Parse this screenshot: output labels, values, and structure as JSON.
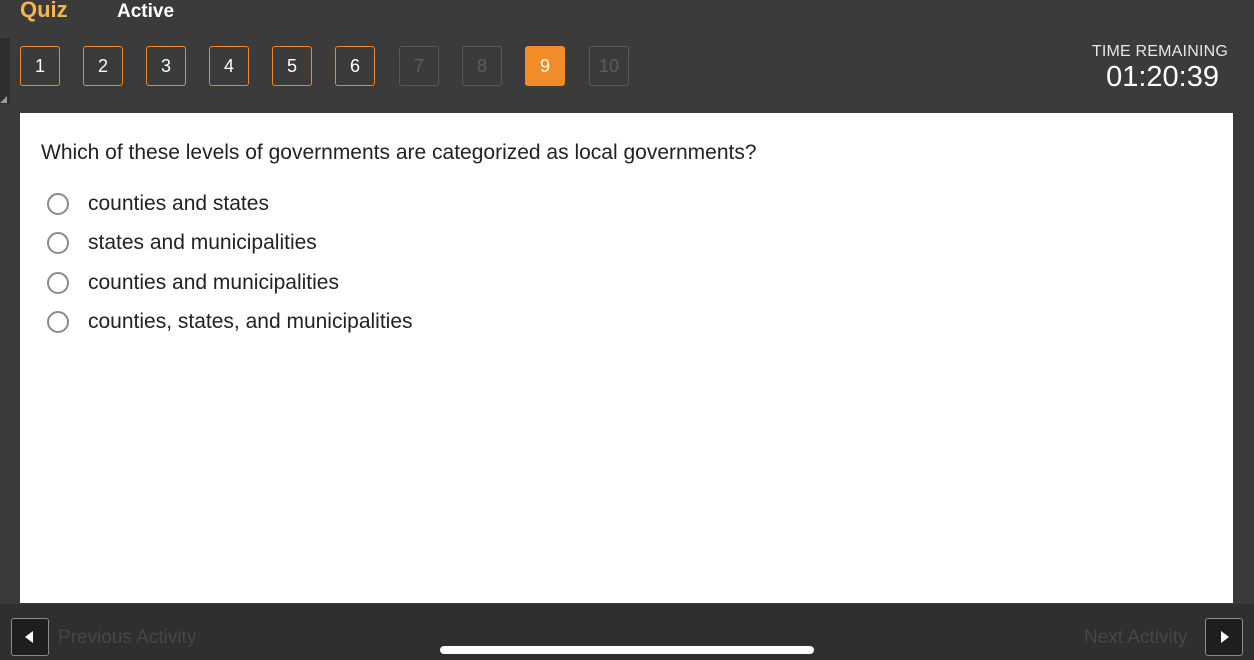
{
  "header": {
    "title": "Quiz",
    "status": "Active",
    "time_label": "TIME REMAINING",
    "time_value": "01:20:39"
  },
  "question_nav": [
    {
      "label": "1",
      "state": "answered"
    },
    {
      "label": "2",
      "state": "answered"
    },
    {
      "label": "3",
      "state": "answered"
    },
    {
      "label": "4",
      "state": "answered"
    },
    {
      "label": "5",
      "state": "answered"
    },
    {
      "label": "6",
      "state": "answered"
    },
    {
      "label": "7",
      "state": "locked"
    },
    {
      "label": "8",
      "state": "locked"
    },
    {
      "label": "9",
      "state": "current"
    },
    {
      "label": "10",
      "state": "locked"
    }
  ],
  "question": {
    "text": "Which of these levels of governments are categorized as local governments?",
    "choices": [
      "counties and states",
      "states and municipalities",
      "counties and municipalities",
      "counties, states, and municipalities"
    ]
  },
  "footer": {
    "prev_label": "Previous Activity",
    "next_label": "Next Activity"
  },
  "colors": {
    "accent": "#f28c28",
    "title": "#f4b64c",
    "background": "#3a3a3a"
  }
}
